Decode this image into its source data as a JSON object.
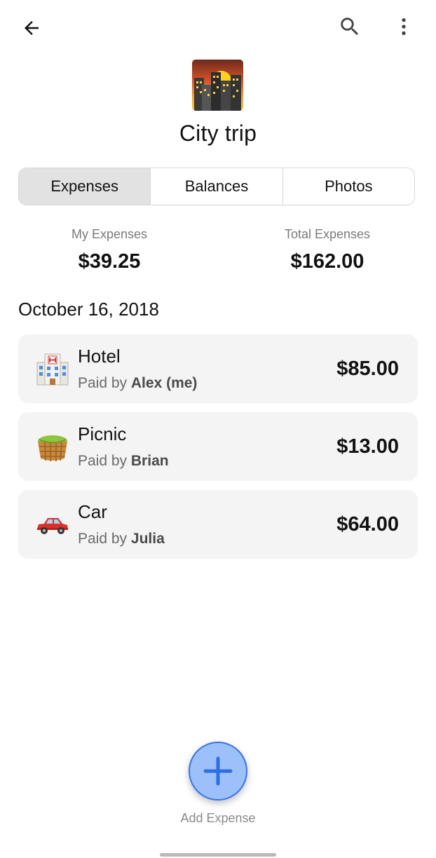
{
  "topbar": {
    "back_icon": "arrow-left-icon",
    "search_icon": "search-icon",
    "more_icon": "more-vert-icon"
  },
  "trip": {
    "title": "City trip",
    "image": "city-sunset-icon"
  },
  "tabs": [
    {
      "label": "Expenses",
      "active": true
    },
    {
      "label": "Balances",
      "active": false
    },
    {
      "label": "Photos",
      "active": false
    }
  ],
  "summary": {
    "my_label": "My Expenses",
    "my_value": "$39.25",
    "total_label": "Total Expenses",
    "total_value": "$162.00"
  },
  "date_header": "October 16, 2018",
  "expenses": [
    {
      "title": "Hotel",
      "paid_prefix": "Paid by ",
      "payer": "Alex (me)",
      "amount": "$85.00",
      "icon": "hotel-icon"
    },
    {
      "title": "Picnic",
      "paid_prefix": "Paid by ",
      "payer": "Brian",
      "amount": "$13.00",
      "icon": "picnic-basket-icon"
    },
    {
      "title": "Car",
      "paid_prefix": "Paid by ",
      "payer": "Julia",
      "amount": "$64.00",
      "icon": "car-icon"
    }
  ],
  "fab": {
    "label": "Add Expense",
    "icon": "plus-icon"
  },
  "colors": {
    "fab_fill": "#9cc0fa",
    "fab_border": "#3b73e6",
    "active_tab": "#e2e2e2",
    "card_bg": "#f4f4f4"
  }
}
